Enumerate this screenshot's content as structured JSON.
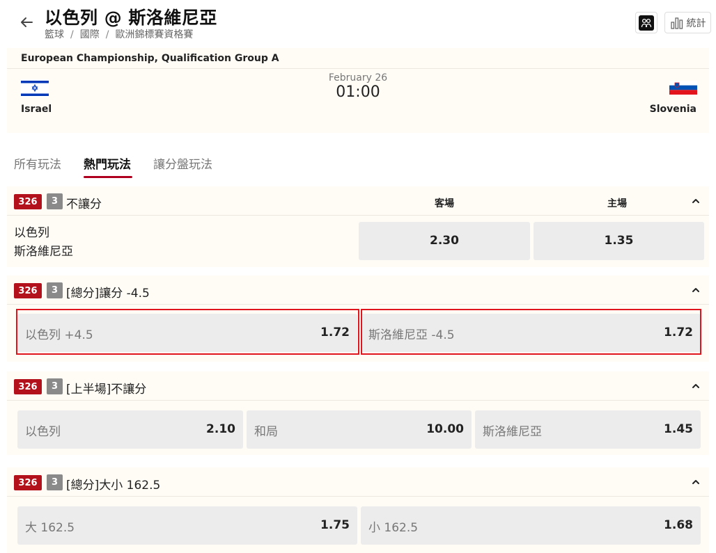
{
  "header": {
    "title": "以色列 @ 斯洛維尼亞",
    "breadcrumb": [
      "籃球",
      "國際",
      "歐洲錦標賽資格賽"
    ],
    "stats_label": "統計"
  },
  "match": {
    "league": "European Championship, Qualification Group A",
    "date": "February 26",
    "time": "01:00",
    "home_team": "Israel",
    "away_team": "Slovenia"
  },
  "tabs": [
    {
      "label": "所有玩法",
      "active": false
    },
    {
      "label": "熱門玩法",
      "active": true
    },
    {
      "label": "讓分盤玩法",
      "active": false
    }
  ],
  "markets": [
    {
      "badge_id": "326",
      "badge_count": "3",
      "title": "不讓分",
      "col_away": "客場",
      "col_home": "主場",
      "team_a": "以色列",
      "team_b": "斯洛維尼亞",
      "odds": [
        "2.30",
        "1.35"
      ]
    },
    {
      "badge_id": "326",
      "badge_count": "3",
      "title": "[總分]讓分 -4.5",
      "options": [
        {
          "label": "以色列 +4.5",
          "odd": "1.72"
        },
        {
          "label": "斯洛維尼亞 -4.5",
          "odd": "1.72"
        }
      ]
    },
    {
      "badge_id": "326",
      "badge_count": "3",
      "title": "[上半場]不讓分",
      "options": [
        {
          "label": "以色列",
          "odd": "2.10"
        },
        {
          "label": "和局",
          "odd": "10.00"
        },
        {
          "label": "斯洛維尼亞",
          "odd": "1.45"
        }
      ]
    },
    {
      "badge_id": "326",
      "badge_count": "3",
      "title": "[總分]大小 162.5",
      "options": [
        {
          "label": "大 162.5",
          "odd": "1.75"
        },
        {
          "label": "小 162.5",
          "odd": "1.68"
        }
      ]
    }
  ],
  "colors": {
    "accent": "#b00020",
    "badge_red": "#b3121c",
    "highlight": "#e0141c"
  }
}
